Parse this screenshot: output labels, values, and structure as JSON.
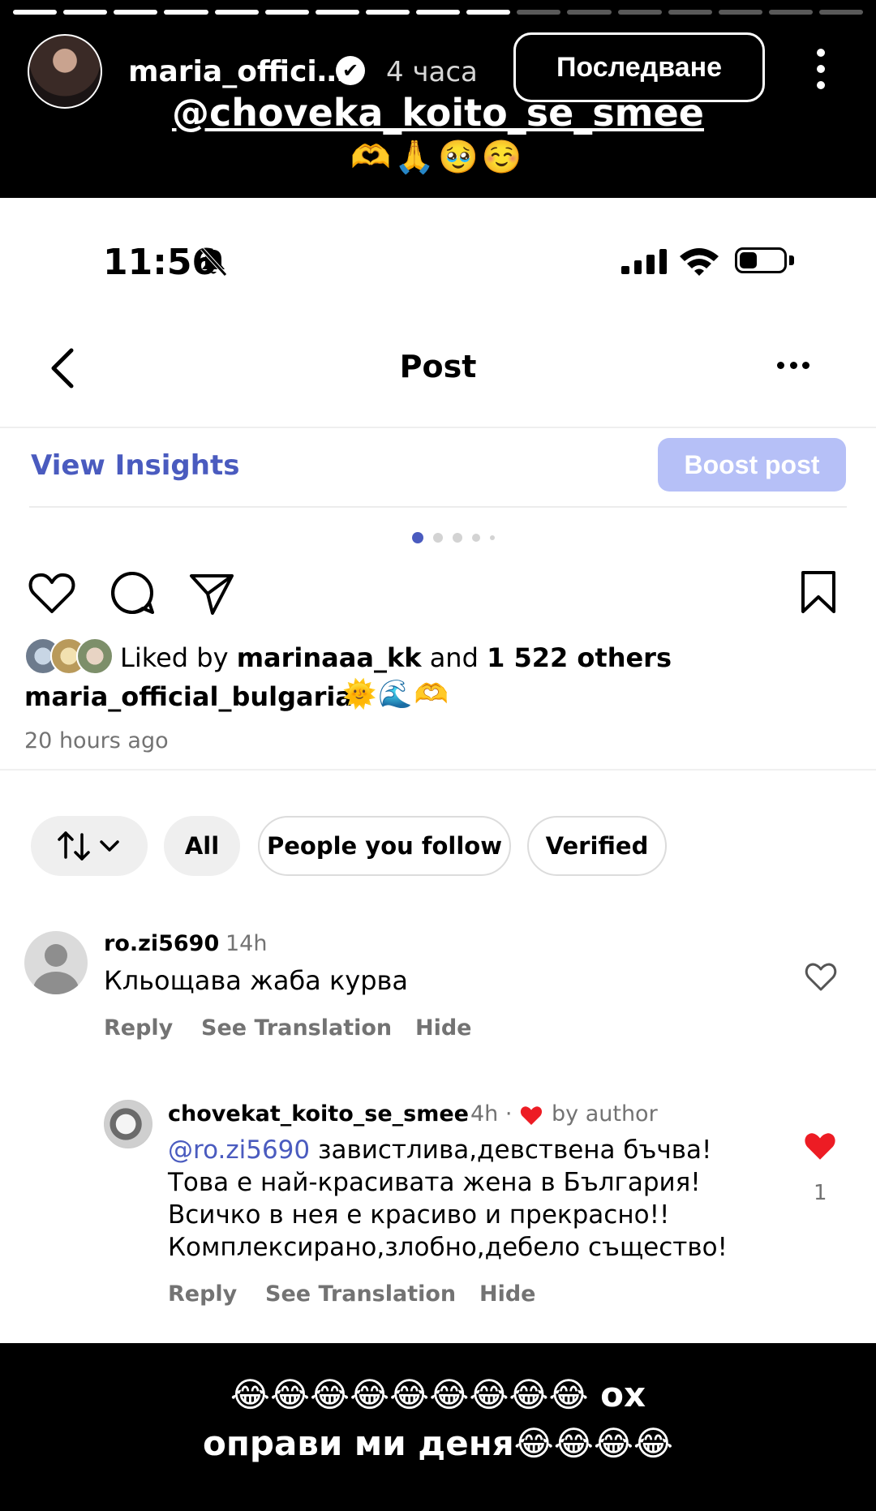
{
  "story": {
    "progress": {
      "segments": 17,
      "completed": 10
    },
    "username": "maria_offici…",
    "verified_mark": "✔",
    "time": "4 часа",
    "follow_label": "Последване",
    "mention": "@choveka_koito_se_smee",
    "emoji_line": "🫶🙏🥹☺️",
    "bottom_caption_line1": "😂😂😂😂😂😂😂😂😂 ох",
    "bottom_caption_line2": "оправи ми деня😂😂😂😂"
  },
  "status_bar": {
    "time": "11:56",
    "battery_level": 0.4
  },
  "header": {
    "title": "Post",
    "back_icon": "chevron-left-icon",
    "more_icon": "ellipsis-icon"
  },
  "actions_bar": {
    "insights_label": "View Insights",
    "boost_label": "Boost post"
  },
  "carousel": {
    "count": 5,
    "active": 1
  },
  "post": {
    "icons": [
      "heart-icon",
      "comment-icon",
      "share-icon",
      "bookmark-icon"
    ],
    "liked_prefix": "Liked by ",
    "liked_user": "marinaaa_kk",
    "liked_mid": " and ",
    "liked_count": "1 522 others",
    "caption_user": "maria_official_bulgaria",
    "caption_emoji": "🌞🌊🫶",
    "time_ago": "20 hours ago"
  },
  "filters": {
    "sort_icon": "sort-arrows-icon",
    "chips": [
      "All",
      "People you follow",
      "Verified"
    ]
  },
  "comments": [
    {
      "user": "ro.zi5690",
      "time": "14h",
      "text": "Кльощава жаба курва",
      "actions": [
        "Reply",
        "See Translation",
        "Hide"
      ]
    }
  ],
  "reply": {
    "user": "chovekat_koito_se_smee",
    "time": "4h ·",
    "liked_by": "by author",
    "mention": "@ro.zi5690",
    "text_line1": " завистлива,девствена бъчва!",
    "text_line2": "Това е най-красивата жена в България!",
    "text_line3": "Всичко в нея е красиво и прекрасно!!",
    "text_line4": "Комплексирано,злобно,дебело същество!",
    "likes": "1",
    "actions": [
      "Reply",
      "See Translation",
      "Hide"
    ]
  },
  "colors": {
    "link": "#4a5bbf",
    "boost": "#b6c0f7",
    "heart": "#ed1c24",
    "muted": "#737373"
  }
}
